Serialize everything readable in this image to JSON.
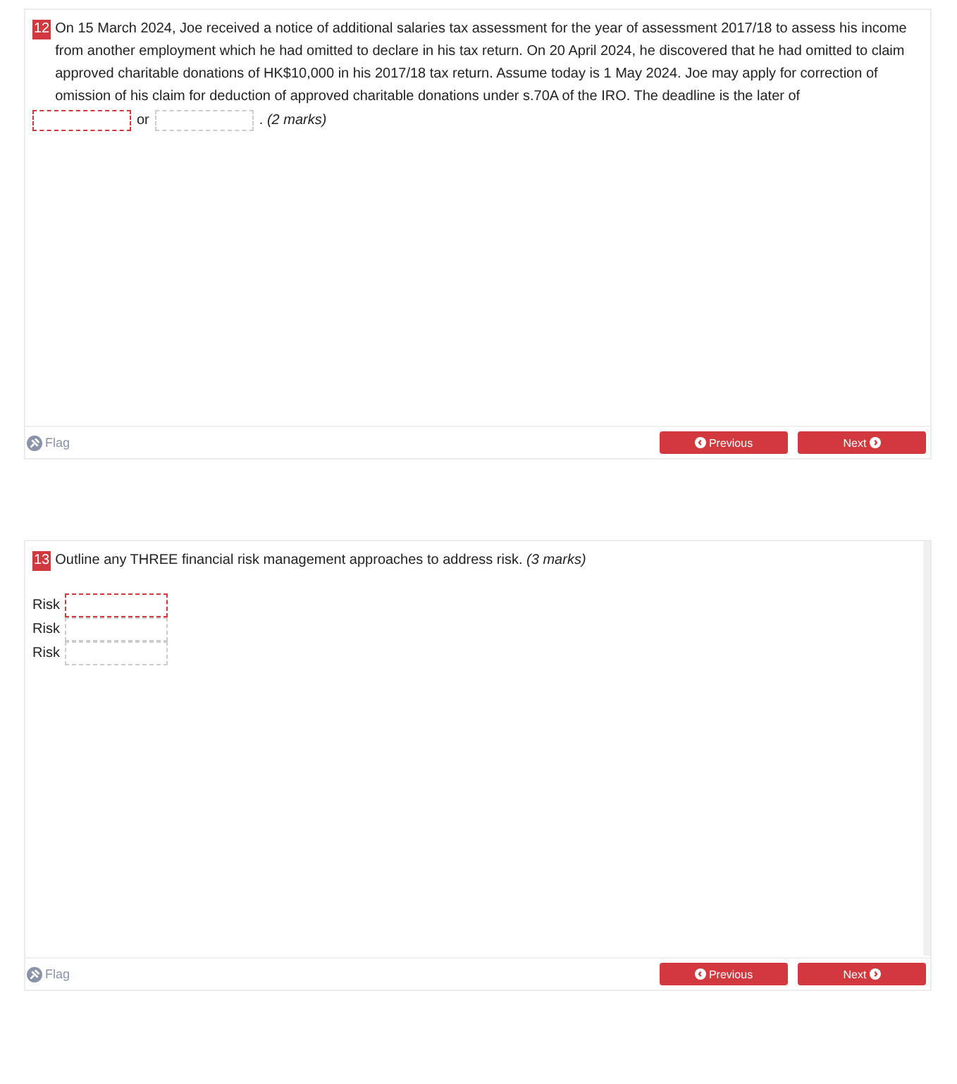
{
  "questions": [
    {
      "number": "12",
      "kind": "fill_in",
      "text": "On 15 March 2024, Joe received a notice of additional salaries tax assessment for the year of assessment 2017/18 to assess his income from another employment which he had omitted to declare in his tax return.  On 20 April 2024, he discovered that he had omitted to claim approved charitable donations of HK$10,000 in his 2017/18 tax return.  Assume today is 1 May 2024.  Joe may apply for correction of omission of his claim for deduction of approved charitable donations under s.70A of the IRO. The deadline is the later of",
      "blanks": [
        {
          "highlighted": true
        },
        {
          "highlighted": false
        }
      ],
      "joiner": "or",
      "ending": ". *(2 marks)*",
      "footer": {
        "flag": "Flag",
        "previous": "Previous",
        "next": "Next"
      }
    },
    {
      "number": "13",
      "kind": "list",
      "text": "Outline any THREE financial risk management approaches to address risk. *(3 marks)*",
      "rows": [
        {
          "label": "Risk",
          "highlighted": true
        },
        {
          "label": "Risk",
          "highlighted": false
        },
        {
          "label": "Risk",
          "highlighted": false
        }
      ],
      "footer": {
        "flag": "Flag",
        "previous": "Previous",
        "next": "Next"
      }
    }
  ]
}
